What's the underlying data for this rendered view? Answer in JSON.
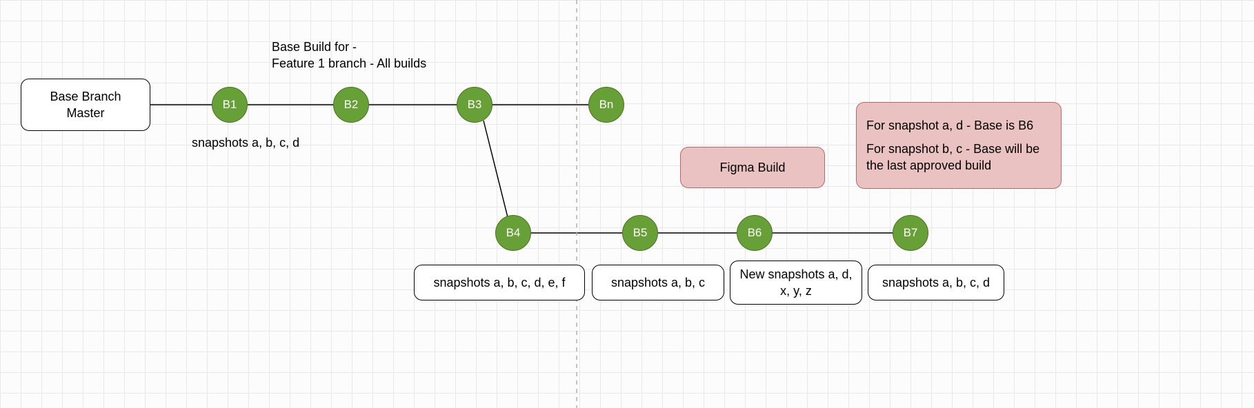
{
  "nodes": {
    "master": {
      "label": "Base Branch\nMaster"
    },
    "b1": {
      "label": "B1"
    },
    "b2": {
      "label": "B2"
    },
    "b3": {
      "label": "B3"
    },
    "bn": {
      "label": "Bn"
    },
    "b4": {
      "label": "B4"
    },
    "b5": {
      "label": "B5"
    },
    "b6": {
      "label": "B6"
    },
    "b7": {
      "label": "B7"
    }
  },
  "annotations": {
    "caption_b2_line1": "Base Build for -",
    "caption_b2_line2": "Feature 1 branch - All builds",
    "snapshots_b1": "snapshots a, b, c, d",
    "snapshots_b4": "snapshots a, b, c, d, e, f",
    "snapshots_b5": "snapshots a, b, c",
    "snapshots_b6": "New snapshots a, d, x, y, z",
    "snapshots_b7": "snapshots a, b, c, d"
  },
  "callouts": {
    "figma": "Figma Build",
    "b7_info_line1": "For snapshot a, d - Base is B6",
    "b7_info_line2": "For snapshot b, c - Base will be the last approved build"
  },
  "chart_data": {
    "type": "diagram",
    "description": "Branch/build lineage diagram showing master branch builds B1..Bn and a feature branch B4..B7 with associated snapshot sets and base-build callouts.",
    "nodes": [
      {
        "id": "master",
        "type": "box",
        "label": "Base Branch Master"
      },
      {
        "id": "B1",
        "type": "build",
        "snapshots": [
          "a",
          "b",
          "c",
          "d"
        ]
      },
      {
        "id": "B2",
        "type": "build",
        "note": "Base Build for - Feature 1 branch - All builds"
      },
      {
        "id": "B3",
        "type": "build"
      },
      {
        "id": "Bn",
        "type": "build"
      },
      {
        "id": "B4",
        "type": "build",
        "snapshots": [
          "a",
          "b",
          "c",
          "d",
          "e",
          "f"
        ]
      },
      {
        "id": "B5",
        "type": "build",
        "snapshots": [
          "a",
          "b",
          "c"
        ]
      },
      {
        "id": "B6",
        "type": "build",
        "snapshots_new": [
          "a",
          "d",
          "x",
          "y",
          "z"
        ],
        "callout": "Figma Build"
      },
      {
        "id": "B7",
        "type": "build",
        "snapshots": [
          "a",
          "b",
          "c",
          "d"
        ],
        "callout": "For snapshot a, d - Base is B6; For snapshot b, c - Base will be the last approved build"
      }
    ],
    "edges": [
      [
        "master",
        "B1"
      ],
      [
        "B1",
        "B2"
      ],
      [
        "B2",
        "B3"
      ],
      [
        "B3",
        "Bn"
      ],
      [
        "B3",
        "B4"
      ],
      [
        "B4",
        "B5"
      ],
      [
        "B5",
        "B6"
      ],
      [
        "B6",
        "B7"
      ]
    ],
    "separator": "vertical dashed divider between Bn/B4 column and B5 column"
  }
}
